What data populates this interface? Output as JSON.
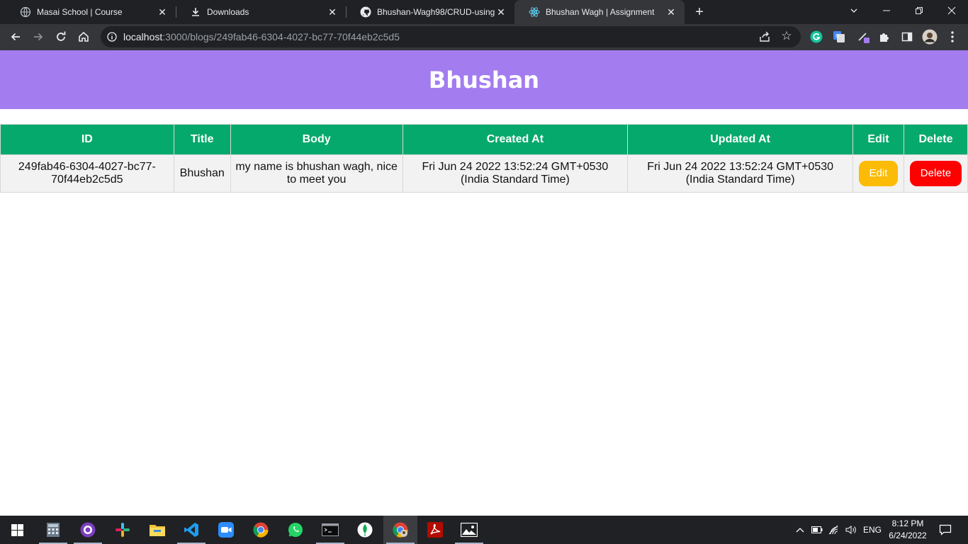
{
  "browser": {
    "tabs": [
      {
        "title": "Masai School | Course",
        "active": false
      },
      {
        "title": "Downloads",
        "active": false
      },
      {
        "title": "Bhushan-Wagh98/CRUD-using-r",
        "active": false
      },
      {
        "title": "Bhushan Wagh | Assignment",
        "active": true
      }
    ],
    "address": {
      "host": "localhost",
      "path": ":3000/blogs/249fab46-6304-4027-bc77-70f44eb2c5d5"
    }
  },
  "page": {
    "heading": "Bhushan",
    "table": {
      "headers": [
        "ID",
        "Title",
        "Body",
        "Created At",
        "Updated At",
        "Edit",
        "Delete"
      ],
      "rows": [
        {
          "id": "249fab46-6304-4027-bc77-70f44eb2c5d5",
          "title": "Bhushan",
          "body": "my name is bhushan wagh, nice to meet you",
          "created_at": "Fri Jun 24 2022 13:52:24 GMT+0530 (India Standard Time)",
          "updated_at": "Fri Jun 24 2022 13:52:24 GMT+0530 (India Standard Time)",
          "edit_label": "Edit",
          "delete_label": "Delete"
        }
      ]
    }
  },
  "taskbar": {
    "language": "ENG",
    "time": "8:12 PM",
    "date": "6/24/2022"
  },
  "colors": {
    "banner": "#a37cf0",
    "table_header": "#06a96c",
    "edit_button": "#fbbb06",
    "delete_button": "#ff0000"
  }
}
